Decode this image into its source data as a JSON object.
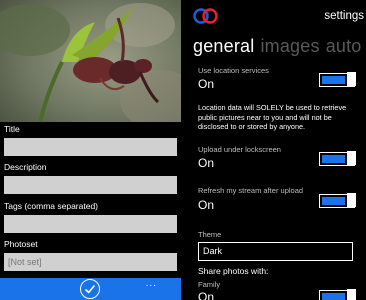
{
  "compose": {
    "fields": [
      {
        "label": "Title",
        "value": ""
      },
      {
        "label": "Description",
        "value": ""
      },
      {
        "label": "Tags (comma separated)",
        "value": ""
      },
      {
        "label": "Photoset",
        "value": "[Not set]"
      }
    ],
    "appbar": {
      "accept_icon": "check-icon",
      "more_label": "..."
    }
  },
  "settings": {
    "title": "settings",
    "pivots": [
      "general",
      "images",
      "auto"
    ],
    "items": [
      {
        "label": "Use location services",
        "value": "On"
      },
      {
        "label": "Upload under lockscreen",
        "value": "On"
      },
      {
        "label": "Refresh my stream after upload",
        "value": "On"
      },
      {
        "label": "Family",
        "value": "On"
      }
    ],
    "location_note": "Location data will SOLELY be used to retrieve public pictures near to you and will not be disclosed to or stored by anyone.",
    "theme": {
      "label": "Theme",
      "value": "Dark"
    },
    "share_label": "Share photos with:"
  },
  "colors": {
    "accent": "#1a73e8",
    "logo_blue": "#1f5fd6",
    "logo_red": "#e8203c"
  }
}
